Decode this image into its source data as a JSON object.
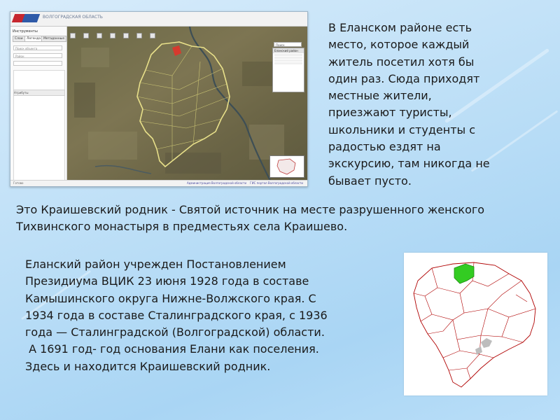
{
  "screenshot": {
    "header_text": "ВОЛГОГРАДСКАЯ ОБЛАСТЬ",
    "panel_title": "Инструменты",
    "tabs": [
      "Слои",
      "Легенда",
      "Метаданные"
    ],
    "field_placeholder": "Поиск объекта",
    "field_2": "Район",
    "toolbar_label": "Атрибуты",
    "search_placeholder": "Поиск",
    "legend_title": "Еланский район",
    "footer_left": "Готово",
    "footer_links": [
      "Администрация Волгоградской области",
      "ГИС портал Волгоградской области"
    ]
  },
  "paragraph1": [
    "В Еланском районе есть",
    "место, которое каждый",
    "житель посетил хотя бы",
    "один раз. Сюда приходят",
    "местные жители,",
    "приезжают туристы,",
    "школьники и студенты с",
    "радостью ездят на",
    "экскурсию, там никогда не",
    "бывает пусто."
  ],
  "paragraph2": [
    "Это Краишевский родник - Святой источник на месте разрушенного женского",
    "Тихвинского монастыря в предместьях села Краишево."
  ],
  "paragraph3": [
    "Еланский район учрежден Постановлением",
    "Президиума ВЦИК 23 июня 1928 года в составе",
    "Камышинского округа Нижне-Волжского края. С",
    "1934 года в составе Сталинградского края, с 1936",
    "года — Сталинградской (Волгоградской) области.",
    " А 1691 год- год основания Елани как поселения.",
    "Здесь и находится Краишевский родник."
  ],
  "colors": {
    "highlight_district": "#33cc22",
    "region_border": "#b00000",
    "map_boundary": "#e8e08a"
  }
}
